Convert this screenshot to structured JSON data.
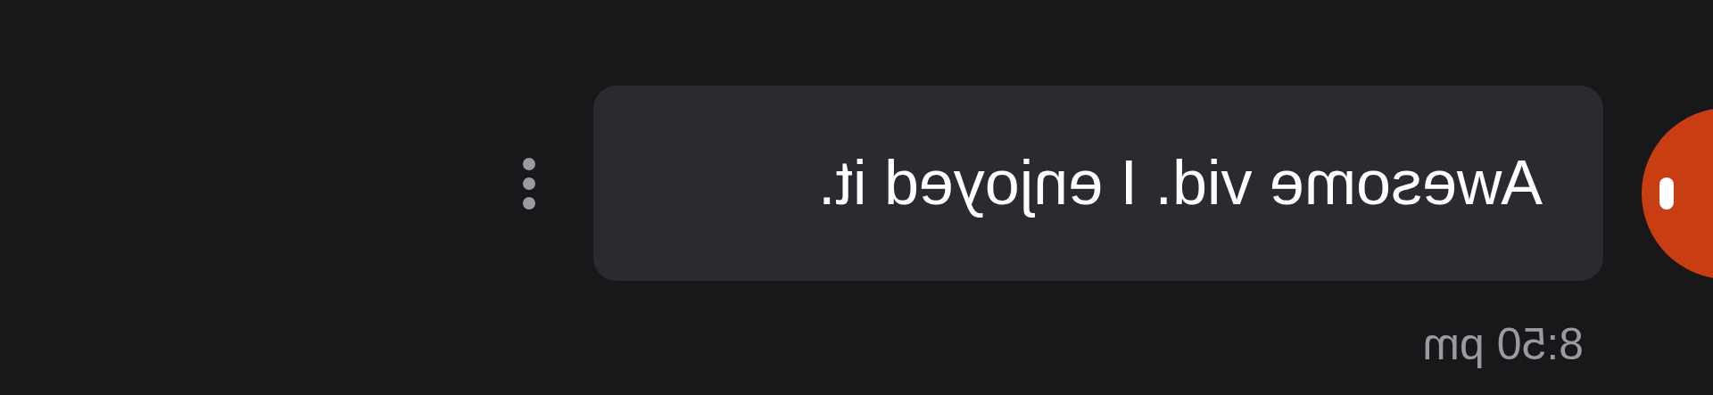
{
  "message": {
    "text": "Awesome vid. I enjoyed it.",
    "time": "8:50 pm"
  }
}
